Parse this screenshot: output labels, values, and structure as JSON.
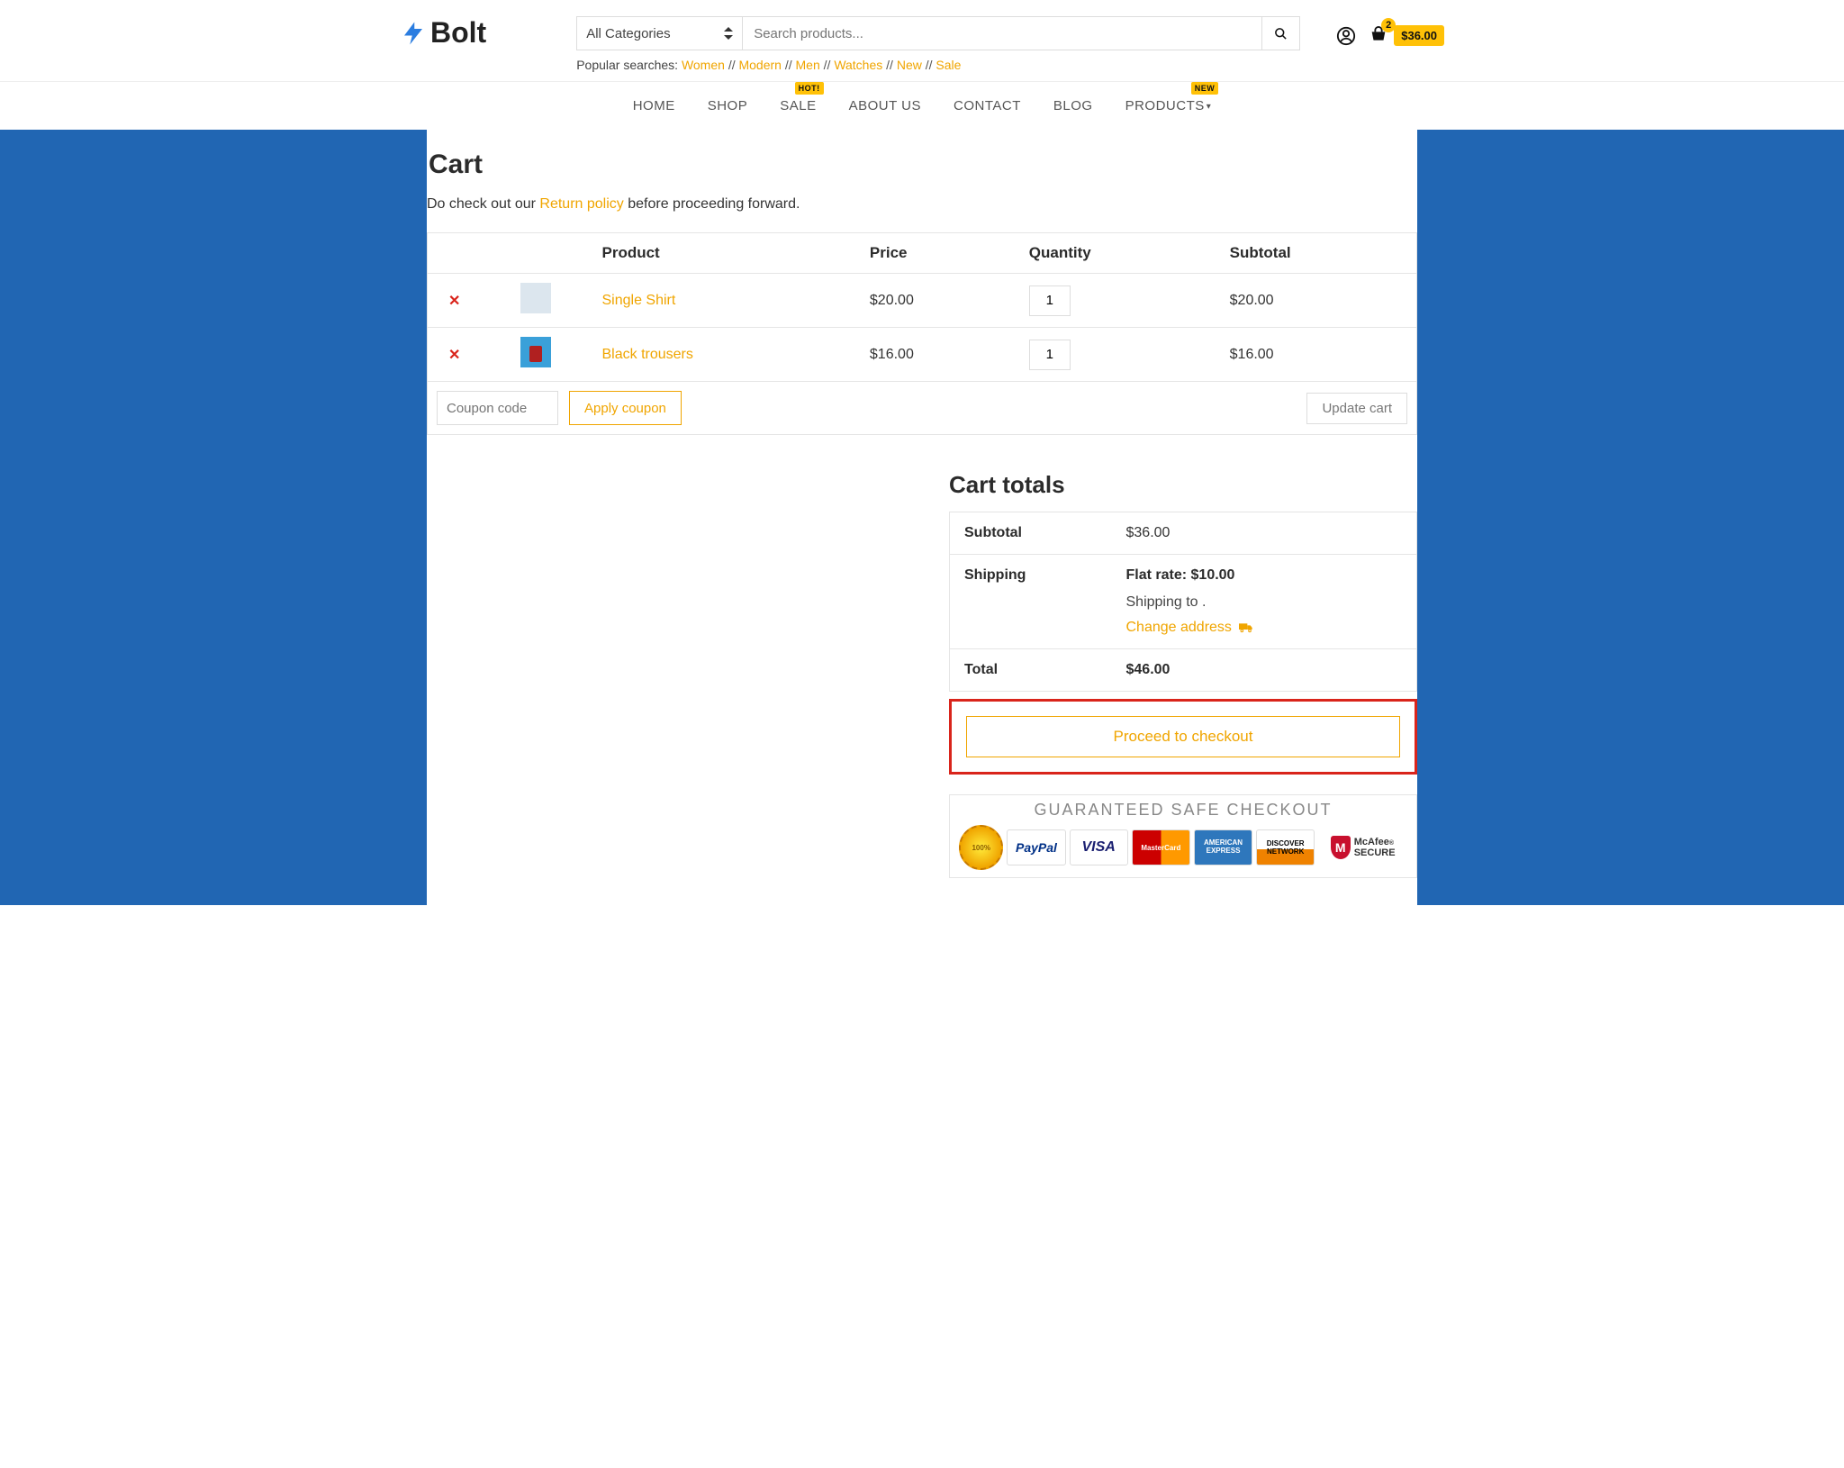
{
  "logo": {
    "text": "Bolt"
  },
  "search": {
    "category": "All Categories",
    "placeholder": "Search products..."
  },
  "popular": {
    "label": "Popular searches:",
    "links": [
      "Women",
      "Modern",
      "Men",
      "Watches",
      "New",
      "Sale"
    ]
  },
  "header_cart": {
    "count": "2",
    "total": "$36.00"
  },
  "nav": {
    "items": [
      "HOME",
      "SHOP",
      "SALE",
      "ABOUT US",
      "CONTACT",
      "BLOG",
      "PRODUCTS"
    ],
    "badges": {
      "sale": "HOT!",
      "products": "NEW"
    }
  },
  "page": {
    "title": "Cart",
    "intro_pre": "Do check out our ",
    "intro_link": "Return policy",
    "intro_post": " before proceeding forward."
  },
  "cart": {
    "headers": {
      "product": "Product",
      "price": "Price",
      "qty": "Quantity",
      "subtotal": "Subtotal"
    },
    "items": [
      {
        "name": "Single Shirt",
        "price": "$20.00",
        "qty": "1",
        "subtotal": "$20.00"
      },
      {
        "name": "Black trousers",
        "price": "$16.00",
        "qty": "1",
        "subtotal": "$16.00"
      }
    ],
    "coupon_placeholder": "Coupon code",
    "apply_label": "Apply coupon",
    "update_label": "Update cart"
  },
  "totals": {
    "title": "Cart totals",
    "subtotal_label": "Subtotal",
    "subtotal": "$36.00",
    "shipping_label": "Shipping",
    "flat_rate_label": "Flat rate: ",
    "flat_rate_value": "$10.00",
    "shipping_to_pre": "Shipping to ",
    "shipping_to_post": " .",
    "change_address": "Change address",
    "total_label": "Total",
    "total": "$46.00",
    "checkout_label": "Proceed to checkout"
  },
  "safe": {
    "title": "GUARANTEED SAFE CHECKOUT",
    "seal": "100%",
    "paypal": "PayPal",
    "visa": "VISA",
    "mastercard": "MasterCard",
    "amex": "AMERICAN EXPRESS",
    "discover": "DISCOVER NETWORK",
    "mcafee_top": "McAfee",
    "mcafee_bottom": "SECURE"
  }
}
